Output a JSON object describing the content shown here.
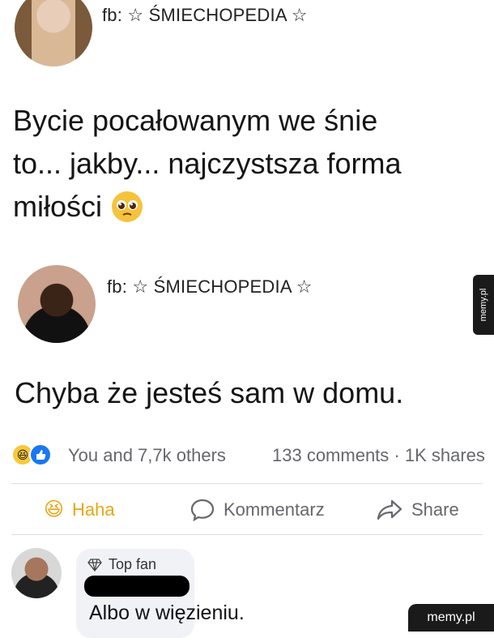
{
  "post1": {
    "source": "fb: ☆ ŚMIECHOPEDIA ☆",
    "lines": [
      "Bycie pocałowanym we śnie",
      "to... jakby... najczystsza forma",
      "miłości"
    ]
  },
  "post2": {
    "source": "fb: ☆ ŚMIECHOPEDIA ☆",
    "text": "Chyba że jesteś sam w domu."
  },
  "side_tab": "memy.pl",
  "stats": {
    "reactions": "You and 7,7k others",
    "comments_shares": "133 comments · 1K shares"
  },
  "actions": {
    "haha": "Haha",
    "comment": "Kommentarz",
    "share": "Share"
  },
  "comment": {
    "badge": "Top fan",
    "text": "Albo w więzieniu."
  },
  "watermark": "memy.pl",
  "colors": {
    "haha": "#e7a614",
    "like": "#1877f2",
    "muted": "#65676b"
  }
}
